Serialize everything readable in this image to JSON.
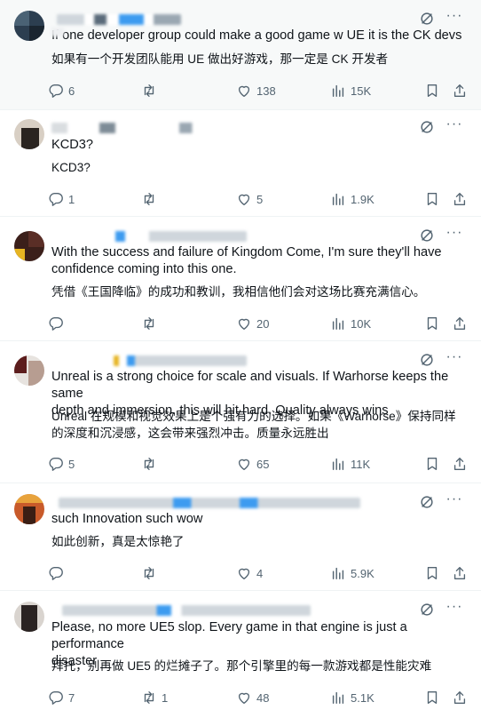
{
  "tweets": [
    {
      "text_lines": [
        "If one developer group could make a good game w UE it is the CK devs"
      ],
      "translation": "如果有一个开发团队能用 UE 做出好游戏，那一定是 CK 开发者",
      "replies": "6",
      "reposts": "",
      "likes": "138",
      "views": "15K"
    },
    {
      "text_lines": [
        "KCD3?"
      ],
      "translation": "KCD3?",
      "replies": "1",
      "reposts": "",
      "likes": "5",
      "views": "1.9K"
    },
    {
      "text_lines": [
        "With the success and failure of Kingdom Come, I'm sure they'll have",
        "confidence coming into this one."
      ],
      "translation": "凭借《王国降临》的成功和教训，我相信他们会对这场比赛充满信心。",
      "replies": "",
      "reposts": "",
      "likes": "20",
      "views": "10K"
    },
    {
      "text_lines": [
        "Unreal is a strong choice for scale and visuals. If Warhorse keeps the same",
        "depth and immersion, this will hit hard. Quality always wins"
      ],
      "translation_lines": [
        "Unreal 在规模和视觉效果上是个强有力的选择。如果《Warhorse》保持同样",
        "的深度和沉浸感，这会带来强烈冲击。质量永远胜出"
      ],
      "replies": "5",
      "reposts": "",
      "likes": "65",
      "views": "11K"
    },
    {
      "text_lines": [
        "such Innovation such wow"
      ],
      "translation": "如此创新，真是太惊艳了",
      "replies": "",
      "reposts": "",
      "likes": "4",
      "views": "5.9K"
    },
    {
      "text_lines": [
        "Please, no more UE5 slop. Every game in that engine is just a performance",
        "disaster"
      ],
      "translation": "拜托，别再做 UE5 的烂摊子了。那个引擎里的每一款游戏都是性能灾难",
      "replies": "7",
      "reposts": "1",
      "likes": "48",
      "views": "5.1K"
    }
  ]
}
